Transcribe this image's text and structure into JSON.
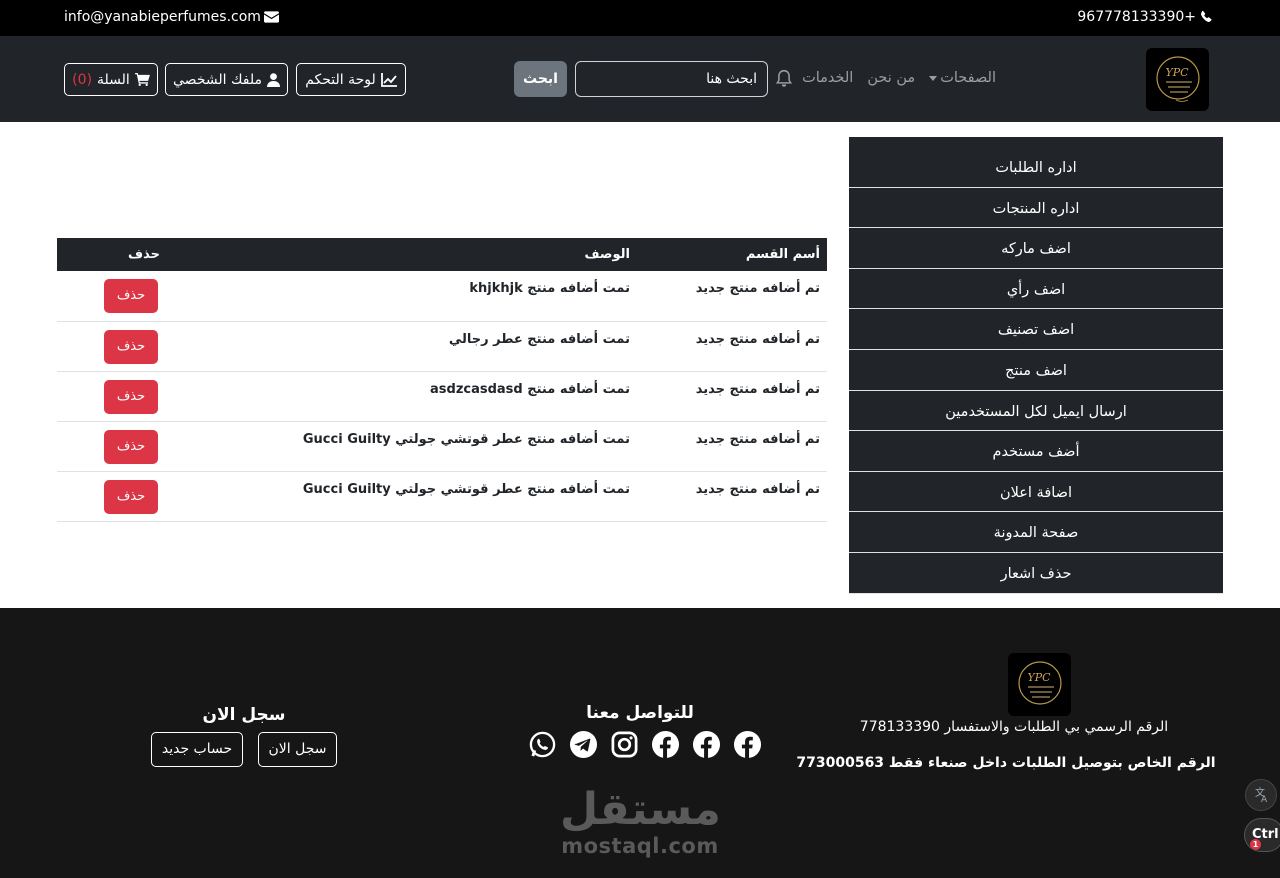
{
  "topbar": {
    "phone": "967778133390+",
    "email": "info@yanabieperfumes.com",
    "phone_icon": "phone-icon",
    "email_icon": "envelope-icon"
  },
  "navbar": {
    "logo_alt": "YPC",
    "links": [
      {
        "label": "الصفحات",
        "dropdown": true
      },
      {
        "label": "من نحن"
      },
      {
        "label": "الخدمات"
      }
    ],
    "bell_icon": "bell-icon",
    "search": {
      "value": "ابحث هنا",
      "button": "ابحث"
    },
    "buttons": {
      "dashboard": "لوحة التحكم",
      "profile": "ملفك الشخصي",
      "cart": "السلة",
      "cart_count": "(0)"
    }
  },
  "sidebar": {
    "items": [
      "اداره الطلبات",
      "اداره المنتجات",
      "اضف ماركه",
      "اضف رأي",
      "اضف تصنيف",
      "اضف منتج",
      "ارسال ايميل لكل المستخدمين",
      "أضف مستخدم",
      "اضافة اعلان",
      "صفحة المدونة",
      "حذف اشعار"
    ]
  },
  "table": {
    "headers": {
      "category": "أسم القسم",
      "description": "الوصف",
      "delete": "حذف"
    },
    "rows": [
      {
        "category": "تم أضافه منتج جديد",
        "description": "تمت أضافه منتج khjkhjk",
        "delete": "حذف"
      },
      {
        "category": "تم أضافه منتج جديد",
        "description": "تمت أضافه منتج عطر رجالي",
        "delete": "حذف"
      },
      {
        "category": "تم أضافه منتج جديد",
        "description": "تمت أضافه منتج asdzcasdasd",
        "delete": "حذف"
      },
      {
        "category": "تم أضافه منتج جديد",
        "description": "تمت أضافه منتج عطر قوتشي جولتي Gucci Guilty",
        "delete": "حذف"
      },
      {
        "category": "تم أضافه منتج جديد",
        "description": "تمت أضافه منتج عطر قوتشي جولتي Gucci Guilty",
        "delete": "حذف"
      }
    ]
  },
  "footer": {
    "official_number": "الرقم الرسمي بي الطلبات والاستفسار 778133390",
    "delivery_number": "الرقم الخاص بتوصيل الطلبات داخل صنعاء فقط  773000563",
    "contact_title": "للتواصل معنا",
    "social_icons": [
      "facebook-icon",
      "facebook-icon",
      "facebook-icon",
      "instagram-icon",
      "telegram-icon",
      "whatsapp-icon"
    ],
    "register_title": "سجل الان",
    "register_button": "سجل الان",
    "new_account_button": "حساب جديد"
  },
  "watermark": {
    "arabic": "مستقل",
    "latin": "mostaql.com"
  },
  "floating": {
    "shortcut": "Ctrl+",
    "badge": "1"
  }
}
